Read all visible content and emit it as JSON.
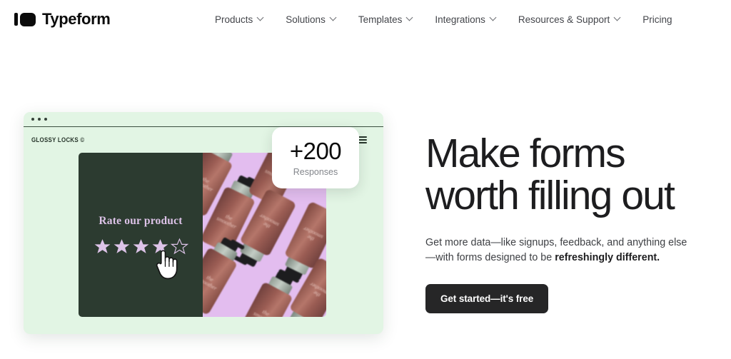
{
  "brand": {
    "name": "Typeform",
    "logo_icon": "typeform-logo-icon"
  },
  "nav": {
    "items": [
      {
        "label": "Products",
        "has_dropdown": true
      },
      {
        "label": "Solutions",
        "has_dropdown": true
      },
      {
        "label": "Templates",
        "has_dropdown": true
      },
      {
        "label": "Integrations",
        "has_dropdown": true
      },
      {
        "label": "Resources & Support",
        "has_dropdown": true
      },
      {
        "label": "Pricing",
        "has_dropdown": false
      }
    ]
  },
  "hero": {
    "headline": "Make forms\nworth filling out",
    "subhead_lead": "Get more data—like signups, feedback, and anything else —with forms designed to be ",
    "subhead_emphasis": "refreshingly different.",
    "cta_label": "Get started—it's free"
  },
  "preview": {
    "window_brand": "GLOSSY LOCKS ©",
    "menu_icon": "hamburger-menu-icon",
    "rating": {
      "question": "Rate our product",
      "stars_total": 5,
      "stars_filled": 4,
      "star_color": "#ddc3e8",
      "panel_color": "#2c3b30",
      "cursor_icon": "pointing-hand-cursor-icon"
    },
    "product_image": {
      "background_color": "#e3bdef",
      "product_label": "the\nsmoother"
    },
    "badge": {
      "value": "+200",
      "label": "Responses"
    },
    "card_background": "#e2f5e4"
  },
  "colors": {
    "page_background": "#ffffff",
    "text_primary": "#1d1d1f",
    "text_secondary": "#43454a",
    "cta_background": "#262627",
    "mint": "#e2f5e4",
    "dark_green": "#2c3b30",
    "lavender": "#e3bdef"
  }
}
